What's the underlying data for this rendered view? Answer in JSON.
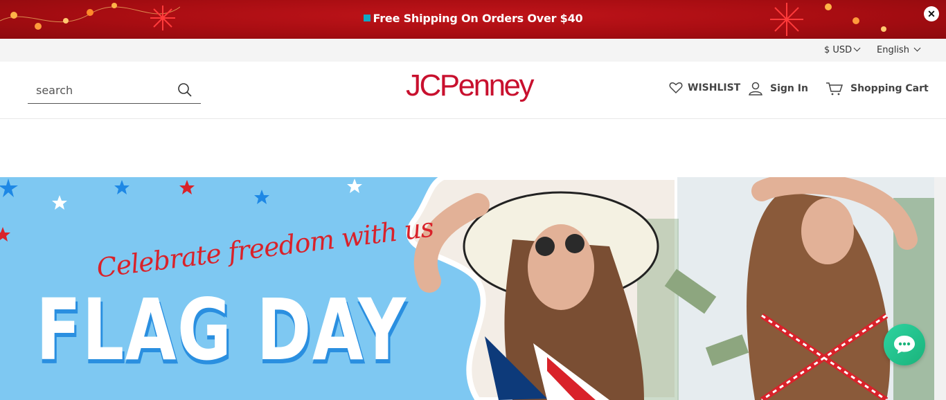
{
  "promo": {
    "text": "Free Shipping On Orders Over $40",
    "close_label": "✕"
  },
  "utility": {
    "currency": "$ USD",
    "language": "English"
  },
  "header": {
    "search_placeholder": "search",
    "logo": "JCPenney",
    "wishlist_label": "WISHLIST",
    "signin_label": "Sign In",
    "cart_label": "Shopping Cart"
  },
  "banner": {
    "script": "Celebrate freedom with us",
    "headline": "FLAG DAY"
  },
  "colors": {
    "brand_red": "#c8102e",
    "promo_red": "#a80d12",
    "banner_blue": "#7ec8f2",
    "chat_green": "#1ab37b"
  }
}
